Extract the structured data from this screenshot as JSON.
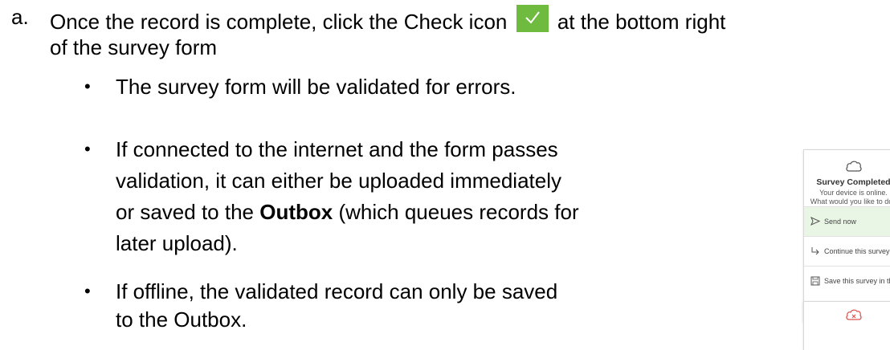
{
  "step_a": {
    "marker": "a.",
    "line1_before_icon": "Once the record is complete, click the Check icon",
    "line1_after_icon": "at the bottom right",
    "line2": "of the survey form",
    "check_icon": "check-icon"
  },
  "bullets": [
    {
      "marker": "•",
      "lines": [
        "The survey form will be validated for errors."
      ]
    },
    {
      "marker": "•",
      "lines": [
        "If connected to the internet and the form passes",
        "validation, it can either be uploaded immediately"
      ]
    },
    {
      "marker": "•",
      "lines": [
        "If offline, the validated record can only be saved",
        "to the Outbox."
      ]
    }
  ],
  "bullet2_line3_before": "or saved to the ",
  "bullet2_line3_bold": "Outbox",
  "bullet2_line3_after": " (which queues records for",
  "bullet2_line4": "later upload).",
  "online_card": {
    "icon": "cloud-icon",
    "title": "Survey Completed",
    "message_lines": [
      "Your device is online.",
      "What would you like to do?"
    ],
    "options": [
      {
        "icon": "send-icon",
        "label": "Send now",
        "active": true
      },
      {
        "icon": "continue-arrow-icon",
        "label": "Continue this survey",
        "active": false
      },
      {
        "icon": "save-icon",
        "label": "Save this survey in the Outbox",
        "active": false
      }
    ]
  },
  "offline_card": {
    "icon": "cloud-offline-icon"
  },
  "colors": {
    "check_green": "#6fbb3f",
    "active_option_bg": "#e9f6e5",
    "offline_icon_red": "#d9534f"
  }
}
